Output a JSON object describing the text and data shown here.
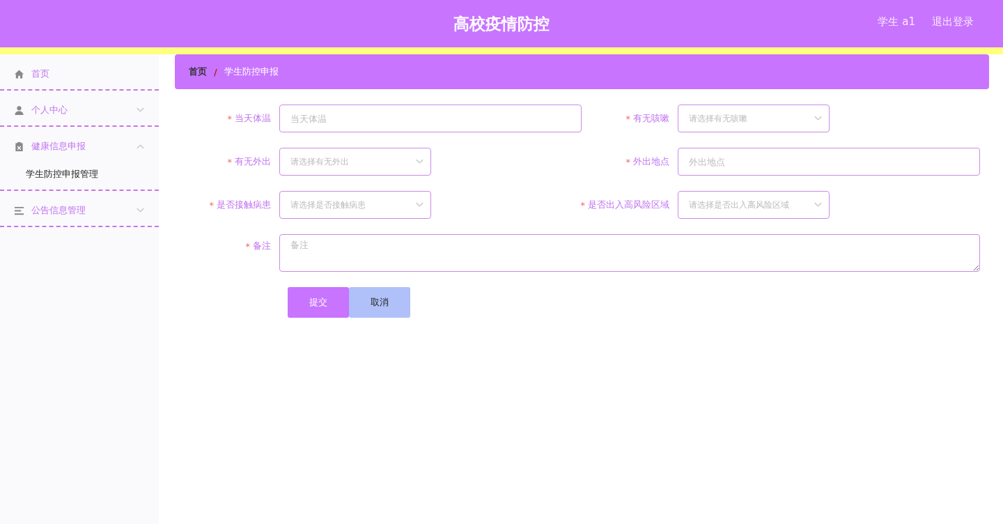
{
  "header": {
    "title": "高校疫情防控",
    "user": "学生 a1",
    "logout": "退出登录"
  },
  "sidebar": {
    "items": [
      {
        "label": "首页"
      },
      {
        "label": "个人中心",
        "expanded": false
      },
      {
        "label": "健康信息申报",
        "expanded": true,
        "children": [
          {
            "label": "学生防控申报管理"
          }
        ]
      },
      {
        "label": "公告信息管理",
        "expanded": false
      }
    ]
  },
  "breadcrumb": {
    "items": [
      "首页",
      "学生防控申报"
    ],
    "separator": "/"
  },
  "form": {
    "required_mark": "*",
    "rows": [
      [
        {
          "label": "当天体温",
          "required": true,
          "kind": "text",
          "placeholder": "当天体温"
        },
        {
          "label": "有无咳嗽",
          "required": true,
          "kind": "select",
          "placeholder": "请选择有无咳嗽"
        }
      ],
      [
        {
          "label": "有无外出",
          "required": true,
          "kind": "select",
          "placeholder": "请选择有无外出"
        },
        {
          "label": "外出地点",
          "required": true,
          "kind": "text",
          "placeholder": "外出地点"
        }
      ],
      [
        {
          "label": "是否接触病患",
          "required": true,
          "kind": "select",
          "placeholder": "请选择是否接触病患"
        },
        {
          "label": "是否出入高风险区域",
          "required": true,
          "kind": "select",
          "placeholder": "请选择是否出入高风险区域"
        }
      ],
      [
        {
          "label": "备注",
          "required": true,
          "kind": "textarea",
          "placeholder": "备注"
        }
      ]
    ],
    "buttons": [
      {
        "label": "提交",
        "kind": "primary"
      },
      {
        "label": "取消",
        "kind": "secondary"
      }
    ]
  }
}
